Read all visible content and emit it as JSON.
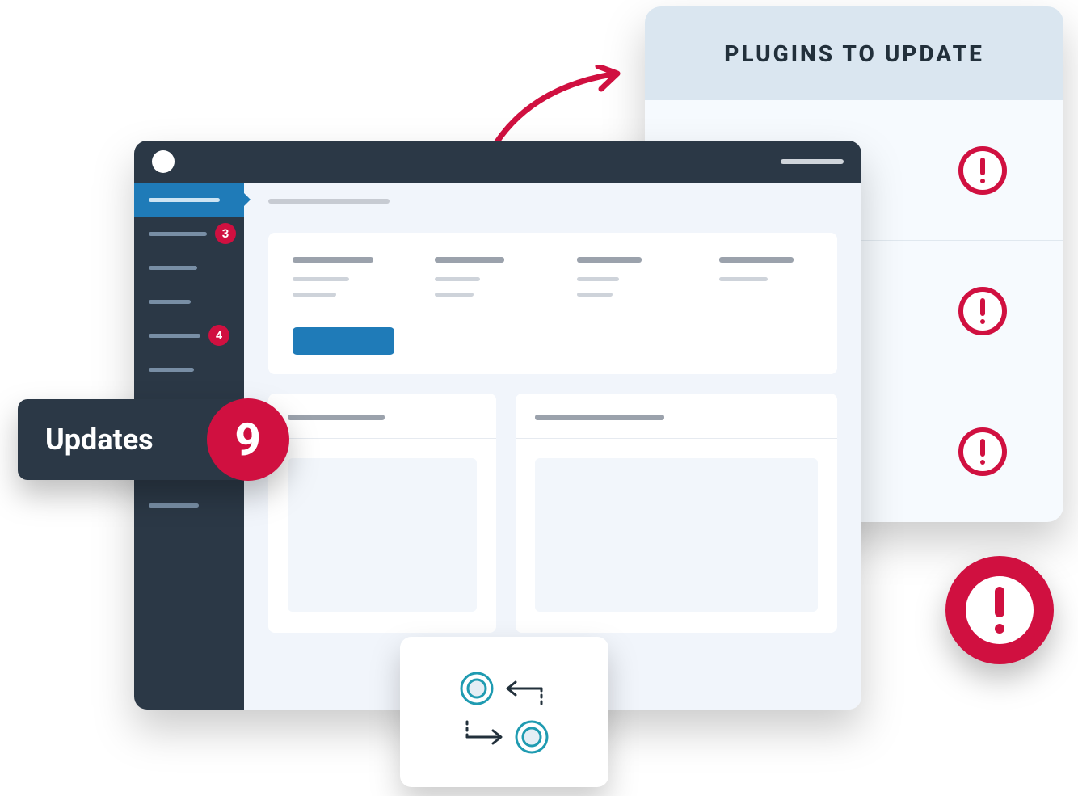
{
  "plugins_panel": {
    "title": "PLUGINS TO UPDATE",
    "rows": 3
  },
  "updates_callout": {
    "label": "Updates",
    "count": "9"
  },
  "sidebar": {
    "badges": {
      "item1": "3",
      "item4": "4"
    }
  },
  "colors": {
    "accent_red": "#d01040",
    "accent_blue": "#1f7bb8",
    "dark": "#2b3846",
    "teal": "#1f9bb1"
  }
}
